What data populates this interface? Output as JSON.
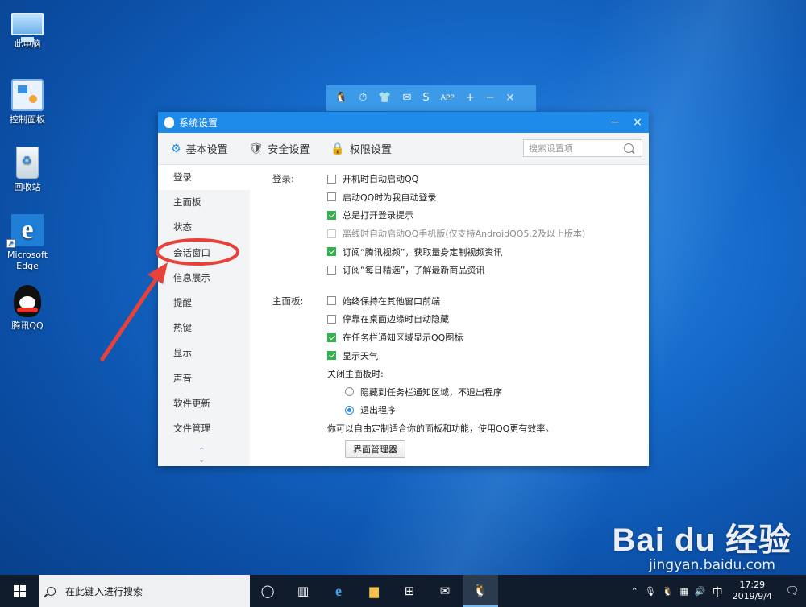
{
  "desktop": {
    "icons": [
      {
        "label": "此电脑"
      },
      {
        "label": "控制面板"
      },
      {
        "label": "回收站"
      },
      {
        "label": "Microsoft Edge"
      },
      {
        "label": "腾讯QQ"
      }
    ]
  },
  "qq_toolbar": {
    "icons": [
      "🐧",
      "⏱",
      "👕",
      "✉",
      "S",
      "APP",
      "+",
      "−",
      "×"
    ]
  },
  "window": {
    "title": "系统设置",
    "controls": {
      "minimize": "−",
      "close": "×"
    },
    "tabs": [
      {
        "label": "基本设置",
        "icon": "⚙"
      },
      {
        "label": "安全设置",
        "icon": "🛡"
      },
      {
        "label": "权限设置",
        "icon": "🔒"
      }
    ],
    "search_placeholder": "搜索设置项",
    "sidebar": {
      "items": [
        "登录",
        "主面板",
        "状态",
        "会话窗口",
        "信息展示",
        "提醒",
        "热键",
        "显示",
        "声音",
        "软件更新",
        "文件管理"
      ],
      "active_index": 0,
      "scroll_up": "⌃",
      "scroll_down": "⌄"
    },
    "login_section": {
      "label": "登录:",
      "options": [
        {
          "text": "开机时自动启动QQ",
          "checked": false,
          "disabled": false
        },
        {
          "text": "启动QQ时为我自动登录",
          "checked": false,
          "disabled": false
        },
        {
          "text": "总是打开登录提示",
          "checked": true,
          "disabled": false
        },
        {
          "text": "离线时自动启动QQ手机版(仅支持AndroidQQ5.2及以上版本)",
          "checked": false,
          "disabled": true
        },
        {
          "text": "订阅“腾讯视频”，获取量身定制视频资讯",
          "checked": true,
          "disabled": false
        },
        {
          "text": "订阅“每日精选”，了解最新商品资讯",
          "checked": false,
          "disabled": false
        }
      ]
    },
    "panel_section": {
      "label": "主面板:",
      "options": [
        {
          "text": "始终保持在其他窗口前端",
          "checked": false
        },
        {
          "text": "停靠在桌面边缘时自动隐藏",
          "checked": false
        },
        {
          "text": "在任务栏通知区域显示QQ图标",
          "checked": true
        },
        {
          "text": "显示天气",
          "checked": true
        }
      ],
      "close_label": "关闭主面板时:",
      "close_options": [
        {
          "text": "隐藏到任务栏通知区域，不退出程序",
          "checked": false
        },
        {
          "text": "退出程序",
          "checked": true
        }
      ],
      "hint": "你可以自由定制适合你的面板和功能，使用QQ更有效率。",
      "manager_button": "界面管理器"
    }
  },
  "watermark": {
    "logo": "Bai du 经验",
    "url": "jingyan.baidu.com"
  },
  "taskbar": {
    "search_placeholder": "在此键入进行搜索",
    "tray_text": "中",
    "time": "17:29",
    "date": "2019/9/4"
  },
  "colors": {
    "titlebar": "#1e8bea",
    "checkbox_checked": "#2fb34a",
    "annotation": "#e8413a"
  }
}
